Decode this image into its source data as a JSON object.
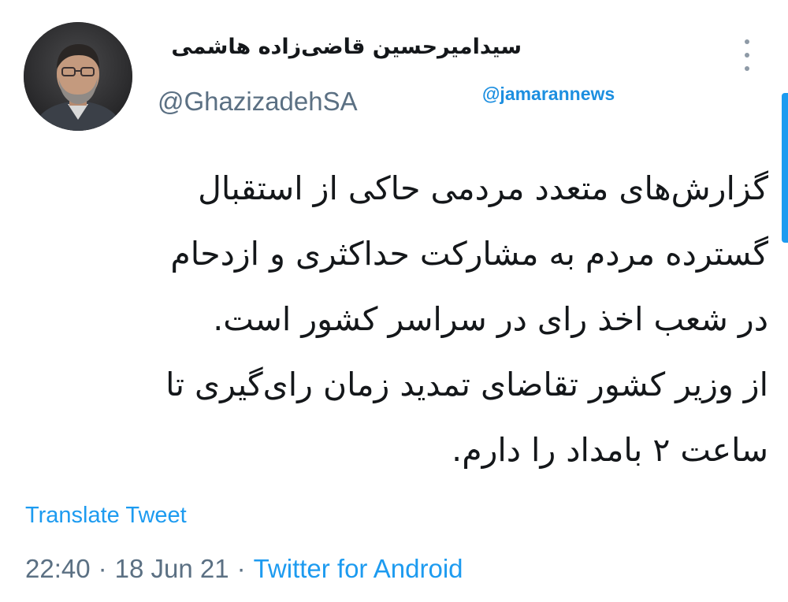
{
  "author": {
    "display_name": "سیدامیرحسین قاضی‌زاده هاشمی",
    "handle": "@GhazizadehSA"
  },
  "watermark": "@jamarannews",
  "tweet": {
    "lines": [
      "گزارش‌های متعدد مردمی حاکی از استقبال",
      "گسترده مردم به مشارکت حداکثری و ازدحام",
      "در شعب اخذ رای در سراسر کشور است.",
      "از وزیر کشور تقاضای تمدید زمان رای‌گیری تا",
      "ساعت ۲ بامداد را دارم."
    ],
    "translate_label": "Translate Tweet",
    "time": "22:40",
    "date": "18 Jun 21",
    "source": "Twitter for Android",
    "separator": "·"
  },
  "icons": {
    "more": "more-vertical-icon"
  },
  "colors": {
    "link": "#1d9bf0",
    "secondary_text": "#5b7083",
    "primary_text": "#14171a",
    "watermark": "#1d8fe0"
  }
}
